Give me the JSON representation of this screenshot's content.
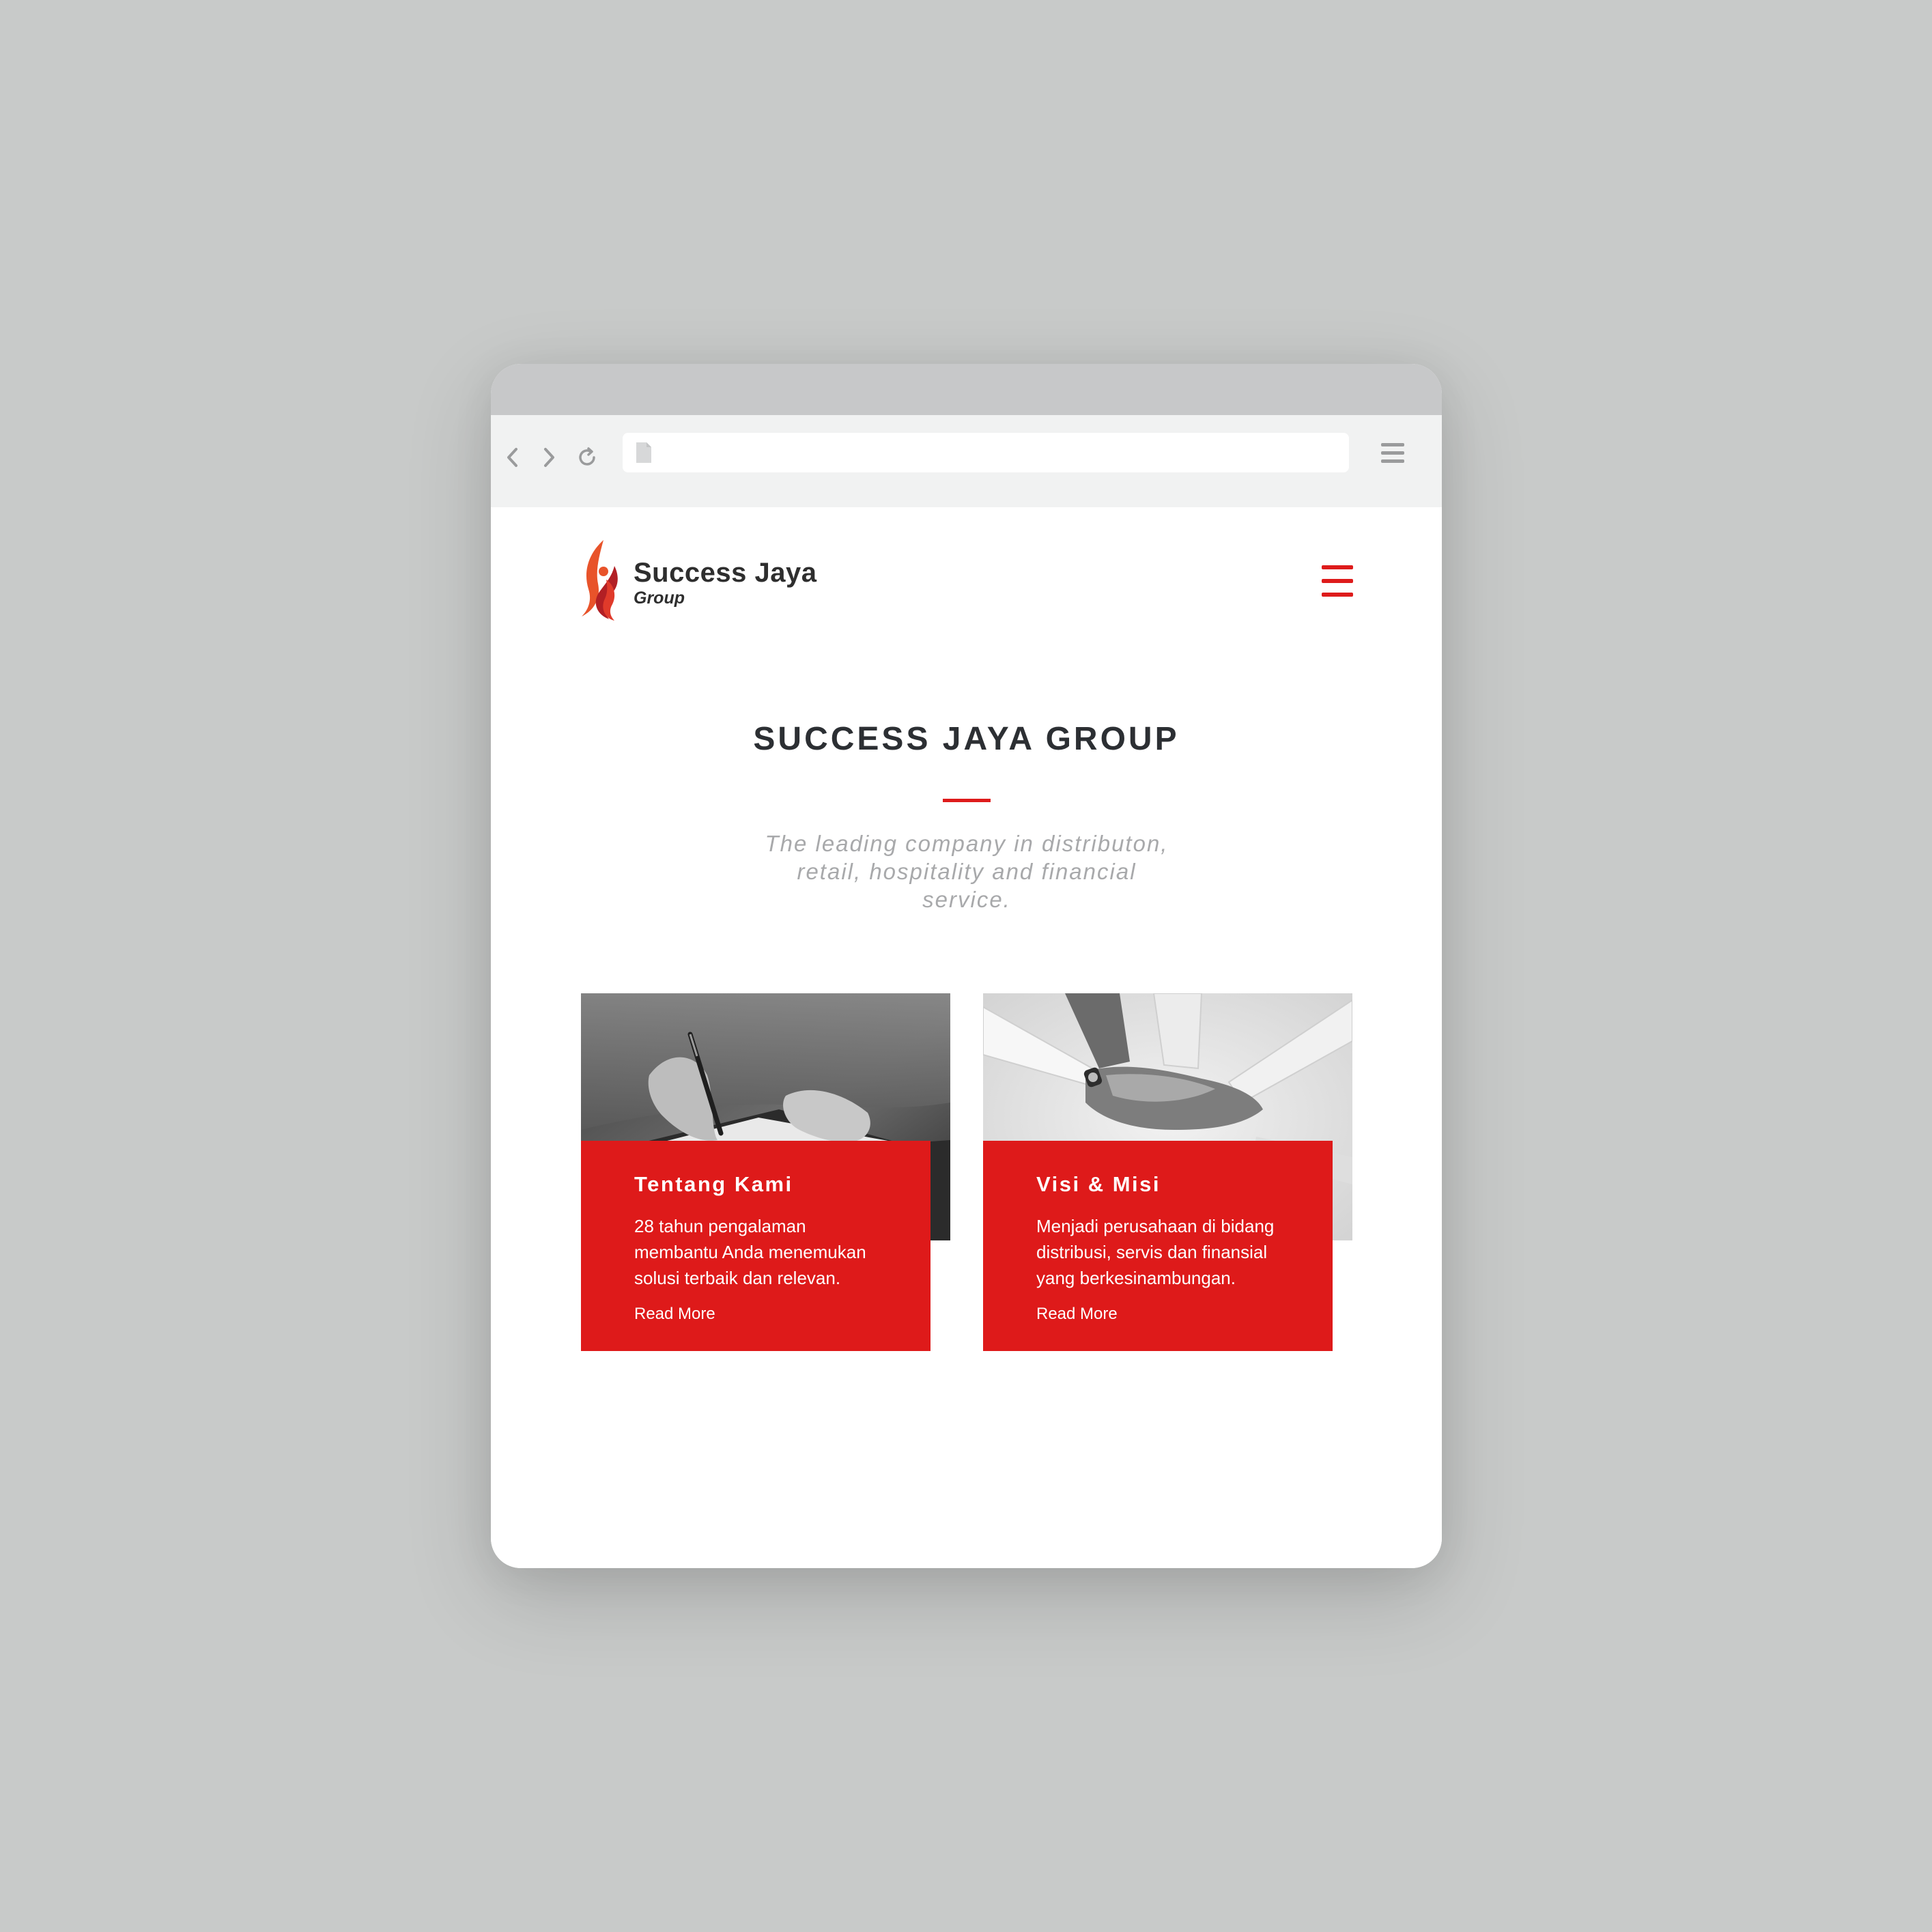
{
  "browser": {
    "url": "",
    "back_icon": "chevron-left-icon",
    "forward_icon": "chevron-right-icon",
    "reload_icon": "reload-icon",
    "menu_icon": "hamburger-icon"
  },
  "header": {
    "logo_name": "Success Jaya",
    "logo_sub": "Group",
    "menu_icon": "hamburger-icon"
  },
  "hero": {
    "title": "SUCCESS JAYA GROUP",
    "tagline": "The leading company in distributon, retail, hospitality and financial service."
  },
  "cards": [
    {
      "title": "Tentang Kami",
      "description": "28 tahun pengalaman membantu Anda menemukan solusi terbaik dan relevan.",
      "link": "Read More"
    },
    {
      "title": "Visi & Misi",
      "description": "Menjadi perusahaan di bidang distribusi, servis dan finansial yang berkesinambungan.",
      "link": "Read More"
    }
  ],
  "colors": {
    "accent": "#de1b1b",
    "background": "#c8cac9",
    "heading": "#2c2f33",
    "muted": "#a8a9ab"
  }
}
